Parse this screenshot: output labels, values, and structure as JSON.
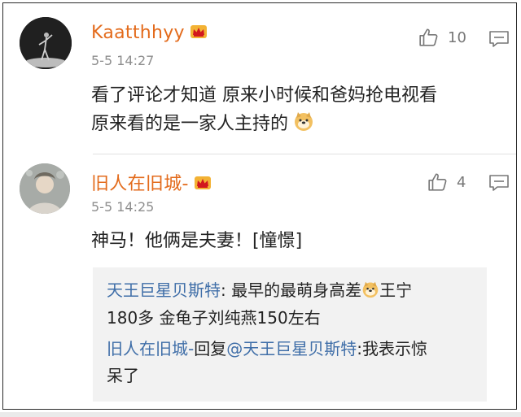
{
  "comments": [
    {
      "username": "Kaatthhyy",
      "timestamp": "5-5 14:27",
      "like_count": "10",
      "text_line1": "看了评论才知道 原来小时候和爸妈抢电视看",
      "text_line2": "原来看的是一家人主持的"
    },
    {
      "username": "旧人在旧城-",
      "timestamp": "5-5 14:25",
      "like_count": "4",
      "text": "神马！他俩是夫妻！[憧憬]",
      "replies": [
        {
          "author": "天王巨星贝斯特",
          "sep": ": ",
          "text_a": "最早的最萌身高差",
          "text_b": "王宁",
          "text_c": "180多 金龟子刘纯燕150左右"
        },
        {
          "author": "旧人在旧城-",
          "reply_word": "回复",
          "mention": "@天王巨星贝斯特",
          "sep": ":",
          "text_a": "我表示惊",
          "text_b": "呆了"
        }
      ]
    }
  ],
  "colors": {
    "username": "#e36b1c",
    "link": "#3f6ea8",
    "timestamp": "#8e8e8e",
    "reply_bg": "#f2f2f2"
  },
  "icons": [
    "crown-badge-icon",
    "thumbs-up-icon",
    "comment-icon",
    "doge-emoji"
  ]
}
